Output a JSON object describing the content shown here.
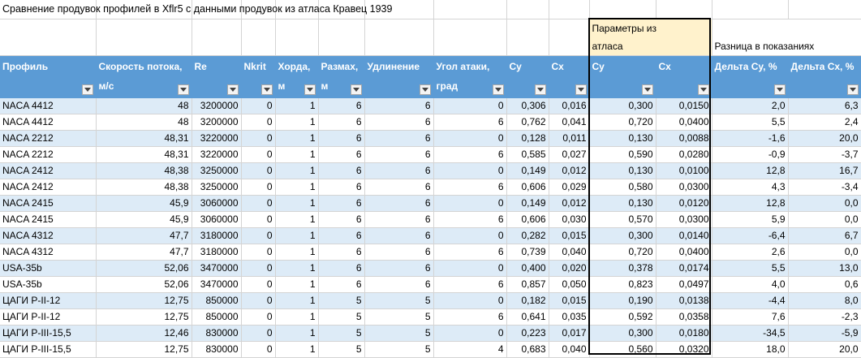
{
  "title": "Сравнение продувок профилей в Xflr5 с данными продувок из атласа Кравец 1939",
  "groups": {
    "atlas": "Параметры из атласа",
    "diff": "Разница в показаниях"
  },
  "headers": {
    "profile": "Профиль",
    "speed": "Скорость потока, м/с",
    "re": "Re",
    "nkrit": "Nkrit",
    "chord": "Хорда, м",
    "span": "Размах, м",
    "aspect": "Удлинение",
    "alpha": "Угол атаки, град",
    "cy": "Cy",
    "cx": "Cx",
    "atlas_cy": "Cy",
    "atlas_cx": "Cx",
    "dcy": "Дельта Cy, %",
    "dcx": "Дельта Cx, %"
  },
  "filter_icon": "dropdown-filter-icon",
  "colors": {
    "header_bg": "#5b9bd5",
    "band_bg": "#ddebf7",
    "atlas_bg": "#fff2cc"
  },
  "rows": [
    [
      "NACA 4412",
      "48",
      "3200000",
      "0",
      "1",
      "6",
      "6",
      "0",
      "0,306",
      "0,016",
      "0,300",
      "0,0150",
      "2,0",
      "6,3"
    ],
    [
      "NACA 4412",
      "48",
      "3200000",
      "0",
      "1",
      "6",
      "6",
      "6",
      "0,762",
      "0,041",
      "0,720",
      "0,0400",
      "5,5",
      "2,4"
    ],
    [
      "NACA 2212",
      "48,31",
      "3220000",
      "0",
      "1",
      "6",
      "6",
      "0",
      "0,128",
      "0,011",
      "0,130",
      "0,0088",
      "-1,6",
      "20,0"
    ],
    [
      "NACA 2212",
      "48,31",
      "3220000",
      "0",
      "1",
      "6",
      "6",
      "6",
      "0,585",
      "0,027",
      "0,590",
      "0,0280",
      "-0,9",
      "-3,7"
    ],
    [
      "NACA 2412",
      "48,38",
      "3250000",
      "0",
      "1",
      "6",
      "6",
      "0",
      "0,149",
      "0,012",
      "0,130",
      "0,0100",
      "12,8",
      "16,7"
    ],
    [
      "NACA 2412",
      "48,38",
      "3250000",
      "0",
      "1",
      "6",
      "6",
      "6",
      "0,606",
      "0,029",
      "0,580",
      "0,0300",
      "4,3",
      "-3,4"
    ],
    [
      "NACA 2415",
      "45,9",
      "3060000",
      "0",
      "1",
      "6",
      "6",
      "0",
      "0,149",
      "0,012",
      "0,130",
      "0,0120",
      "12,8",
      "0,0"
    ],
    [
      "NACA 2415",
      "45,9",
      "3060000",
      "0",
      "1",
      "6",
      "6",
      "6",
      "0,606",
      "0,030",
      "0,570",
      "0,0300",
      "5,9",
      "0,0"
    ],
    [
      "NACA 4312",
      "47,7",
      "3180000",
      "0",
      "1",
      "6",
      "6",
      "0",
      "0,282",
      "0,015",
      "0,300",
      "0,0140",
      "-6,4",
      "6,7"
    ],
    [
      "NACA 4312",
      "47,7",
      "3180000",
      "0",
      "1",
      "6",
      "6",
      "6",
      "0,739",
      "0,040",
      "0,720",
      "0,0400",
      "2,6",
      "0,0"
    ],
    [
      "USA-35b",
      "52,06",
      "3470000",
      "0",
      "1",
      "6",
      "6",
      "0",
      "0,400",
      "0,020",
      "0,378",
      "0,0174",
      "5,5",
      "13,0"
    ],
    [
      "USA-35b",
      "52,06",
      "3470000",
      "0",
      "1",
      "6",
      "6",
      "6",
      "0,857",
      "0,050",
      "0,823",
      "0,0497",
      "4,0",
      "0,6"
    ],
    [
      "ЦАГИ Р-II-12",
      "12,75",
      "850000",
      "0",
      "1",
      "5",
      "5",
      "0",
      "0,182",
      "0,015",
      "0,190",
      "0,0138",
      "-4,4",
      "8,0"
    ],
    [
      "ЦАГИ Р-II-12",
      "12,75",
      "850000",
      "0",
      "1",
      "5",
      "5",
      "6",
      "0,641",
      "0,035",
      "0,592",
      "0,0358",
      "7,6",
      "-2,3"
    ],
    [
      "ЦАГИ Р-III-15,5",
      "12,46",
      "830000",
      "0",
      "1",
      "5",
      "5",
      "0",
      "0,223",
      "0,017",
      "0,300",
      "0,0180",
      "-34,5",
      "-5,9"
    ],
    [
      "ЦАГИ Р-III-15,5",
      "12,75",
      "830000",
      "0",
      "1",
      "5",
      "5",
      "4",
      "0,683",
      "0,040",
      "0,560",
      "0,0320",
      "18,0",
      "20,0"
    ]
  ]
}
